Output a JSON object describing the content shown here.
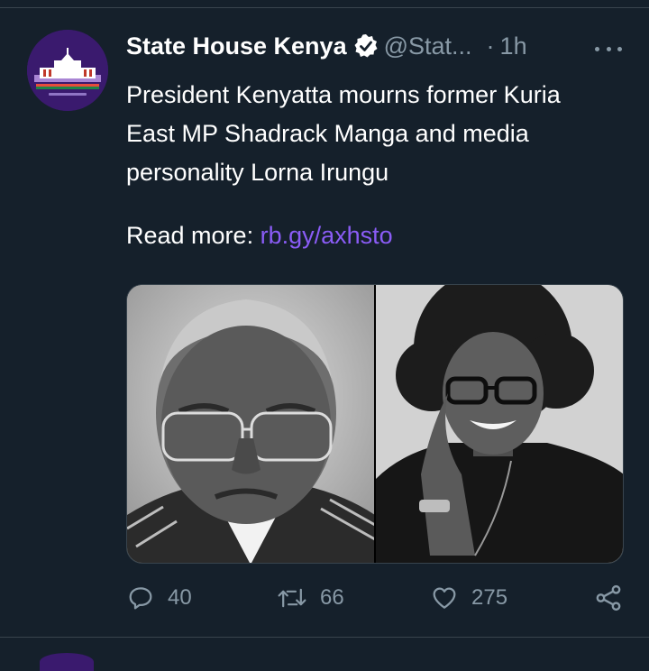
{
  "tweet": {
    "author_name": "State House Kenya",
    "handle": "@Stat...",
    "separator": "·",
    "time": "1h",
    "text_lines": [
      "President Kenyatta mourns former Kuria",
      "East MP Shadrack Manga and media",
      "personality Lorna Irungu"
    ],
    "read_more_label": "Read more:",
    "link_text": "rb.gy/axhsto",
    "media": [
      {
        "icon": "portrait-man-photo"
      },
      {
        "icon": "portrait-woman-photo"
      }
    ],
    "stats": {
      "replies": "40",
      "retweets": "66",
      "likes": "275"
    }
  },
  "colors": {
    "background": "#15202b",
    "secondary_text": "#8899a6",
    "link": "#8a5cf6",
    "divider": "#38444d"
  }
}
